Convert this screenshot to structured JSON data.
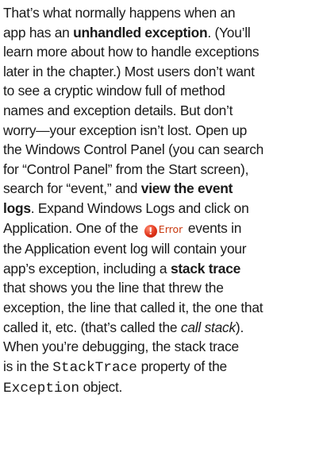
{
  "paragraph": {
    "lines": [
      {
        "pre": "That’s what normally happens when an"
      },
      {
        "pre": " app has an ",
        "bold": "unhandled exception",
        "post": ". (You’ll"
      },
      {
        "pre": "learn more about how to handle exceptions"
      },
      {
        "pre": "later in the chapter.) Most users don’t want"
      },
      {
        "pre": "to see a cryptic window full of method"
      },
      {
        "pre": "names and exception details. But don’t"
      },
      {
        "pre": "worry—your exception isn’t lost. Open up"
      },
      {
        "pre": "the Windows Control Panel (you can search"
      },
      {
        "pre": "for “Control Panel” from the Start screen),"
      },
      {
        "pre": "search for “event,” and ",
        "bold": "view the event"
      },
      {
        "bold": "logs",
        "post": ". Expand Windows Logs and click on"
      },
      {
        "pre": "Application. One of the ",
        "badge": "Error",
        "post": " events in"
      },
      {
        "pre": "the Application event log will contain your"
      },
      {
        "pre": "app’s exception, including a ",
        "bold": "stack trace"
      },
      {
        "pre": "that shows you the line that threw the"
      },
      {
        "pre": "exception, the line that called it, the one that"
      },
      {
        "pre": "called it, etc. (that’s called the ",
        "italic": "call stack",
        "post": ")."
      },
      {
        "pre": "When you’re debugging, the stack trace"
      },
      {
        "pre": "is in the ",
        "code": "StackTrace",
        "post": " property of the"
      },
      {
        "code": "Exception",
        "post": " object."
      }
    ]
  },
  "error_icon": {
    "name": "error-icon",
    "glyph": "!",
    "color": "#e0341a"
  }
}
